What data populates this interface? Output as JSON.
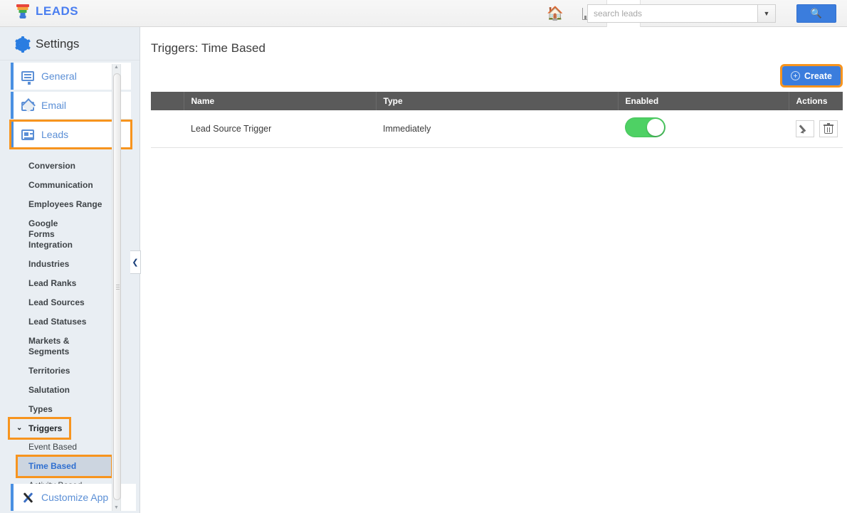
{
  "topbar": {
    "brand": "LEADS",
    "logo_icon": "funnel-icon",
    "home_icon": "home-icon",
    "reports_icon": "bar-chart-icon",
    "more_icon": "three-dots-icon",
    "search_placeholder": "search leads",
    "search_value": "",
    "search_dropdown_icon": "chevron-down-icon",
    "search_button_icon": "search-icon"
  },
  "sidebar": {
    "title": "Settings",
    "gear_icon": "gear-icon",
    "main_items": [
      {
        "label": "General",
        "icon": "monitor-icon",
        "chevron": "›",
        "highlighted": false
      },
      {
        "label": "Email",
        "icon": "envelope-icon",
        "chevron": "›",
        "highlighted": false
      },
      {
        "label": "Leads",
        "icon": "card-list-icon",
        "chevron": "⌄",
        "highlighted": true
      }
    ],
    "sub_items": [
      "Conversion",
      "Communication",
      "Employees Range",
      "Google Forms Integration",
      "Industries",
      "Lead Ranks",
      "Lead Sources",
      "Lead Statuses",
      "Markets & Segments",
      "Territories",
      "Salutation",
      "Types"
    ],
    "triggers_group": {
      "label": "Triggers",
      "chevron": "⌄",
      "highlighted": true,
      "children": [
        {
          "label": "Event Based",
          "selected": false
        },
        {
          "label": "Time Based",
          "selected": true
        },
        {
          "label": "Activity Based",
          "selected": false
        }
      ]
    },
    "bottom_item": {
      "label": "Customize App",
      "icon": "tools-icon"
    },
    "collapse_icon": "chevron-left-icon",
    "scrollbar_up_icon": "scroll-up-icon",
    "scrollbar_down_icon": "scroll-down-icon"
  },
  "main": {
    "page_title": "Triggers: Time Based",
    "create_button": {
      "label": "Create",
      "icon": "plus-circle-icon"
    },
    "table": {
      "columns": [
        "",
        "Name",
        "Type",
        "Enabled",
        "Actions"
      ],
      "rows": [
        {
          "name": "Lead Source Trigger",
          "type": "Immediately",
          "enabled": true,
          "edit_icon": "pencil-icon",
          "delete_icon": "trash-icon"
        }
      ]
    }
  },
  "colors": {
    "accent_blue": "#3b7ddd",
    "link_blue": "#5b8fd6",
    "highlight_orange": "#f7941e",
    "toggle_green": "#4ed164",
    "table_header_gray": "#5a5a5a",
    "sidebar_bg": "#e9eef3"
  }
}
